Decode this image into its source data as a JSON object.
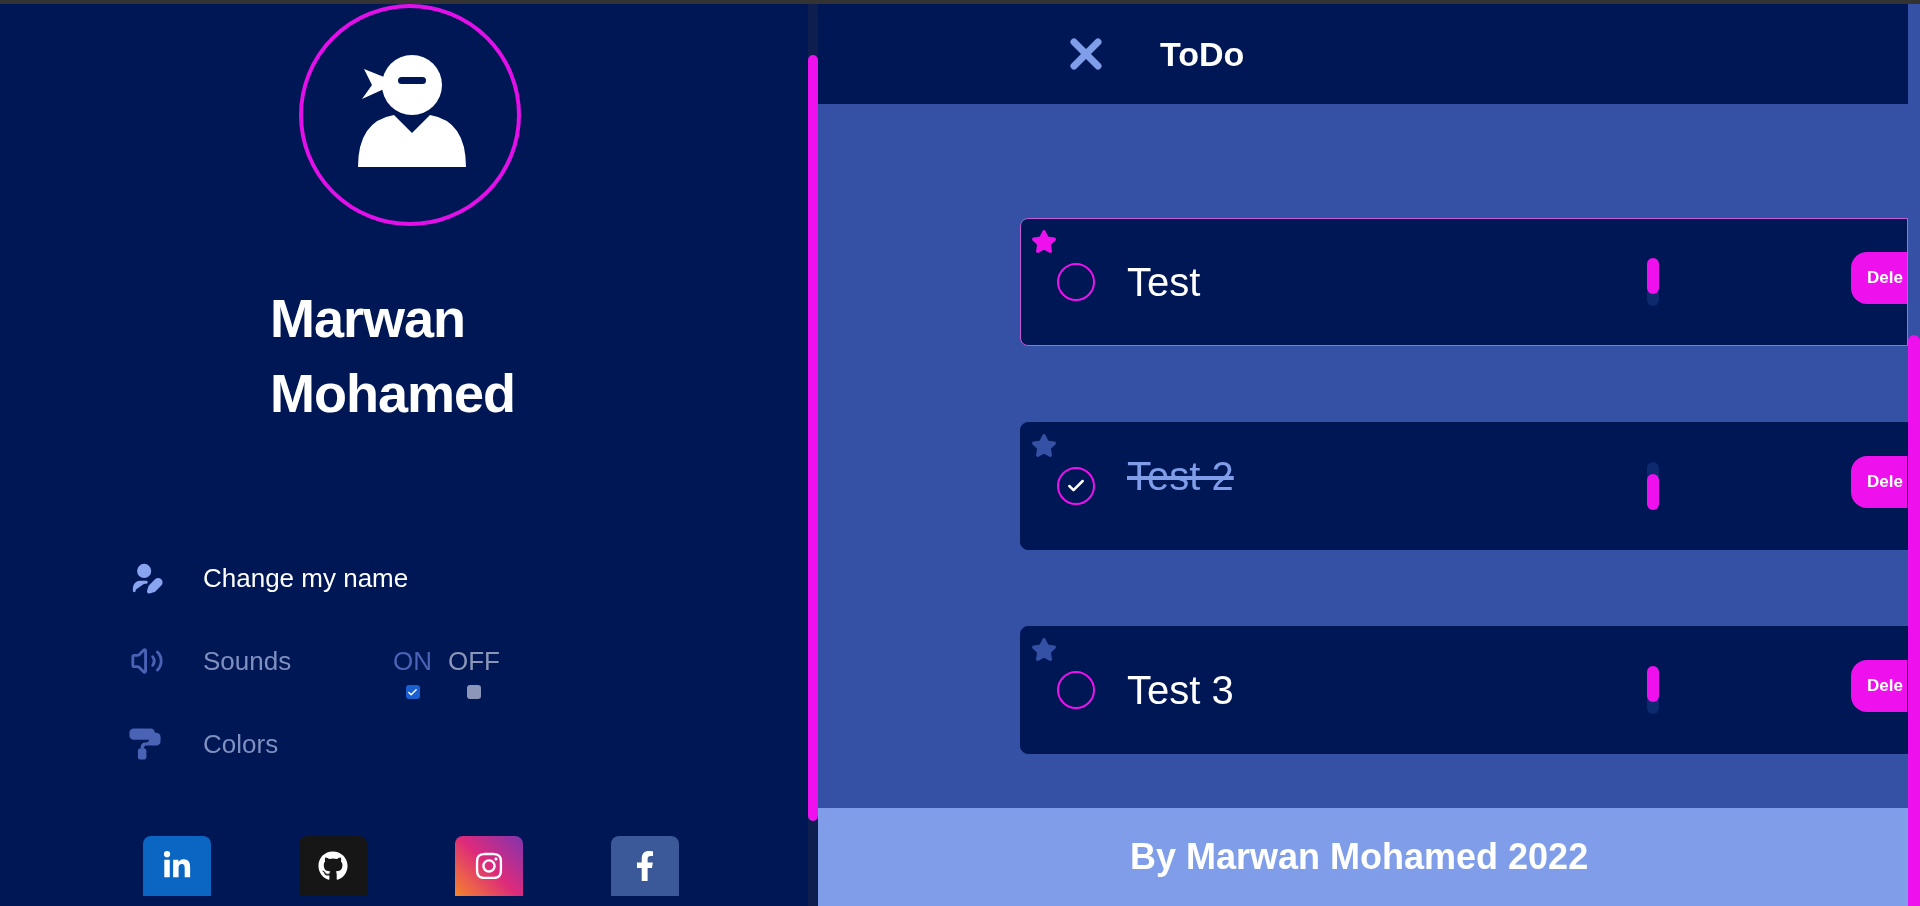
{
  "profile": {
    "name_lines": [
      "Marwan",
      "Mohamed"
    ]
  },
  "menu": [
    {
      "kind": "link",
      "label": "Change my name",
      "active": true
    },
    {
      "kind": "toggle",
      "label": "Sounds",
      "active": false,
      "options": [
        {
          "label": "ON",
          "checked": true
        },
        {
          "label": "OFF",
          "checked": false
        }
      ]
    },
    {
      "kind": "link",
      "label": "Colors",
      "active": false
    }
  ],
  "social": [
    {
      "kind": "linkedin"
    },
    {
      "kind": "github"
    },
    {
      "kind": "instagram"
    },
    {
      "kind": "facebook"
    }
  ],
  "header": {
    "title": "ToDo"
  },
  "tasks": [
    {
      "text": "Test",
      "starred": true,
      "done": false,
      "selected": true,
      "on": true,
      "button": "Dele"
    },
    {
      "text": "Test 2",
      "starred": false,
      "done": true,
      "selected": false,
      "on": false,
      "button": "Dele"
    },
    {
      "text": "Test 3",
      "starred": false,
      "done": false,
      "selected": false,
      "on": true,
      "button": "Dele"
    }
  ],
  "footer": {
    "text": "By Marwan Mohamed 2022"
  }
}
